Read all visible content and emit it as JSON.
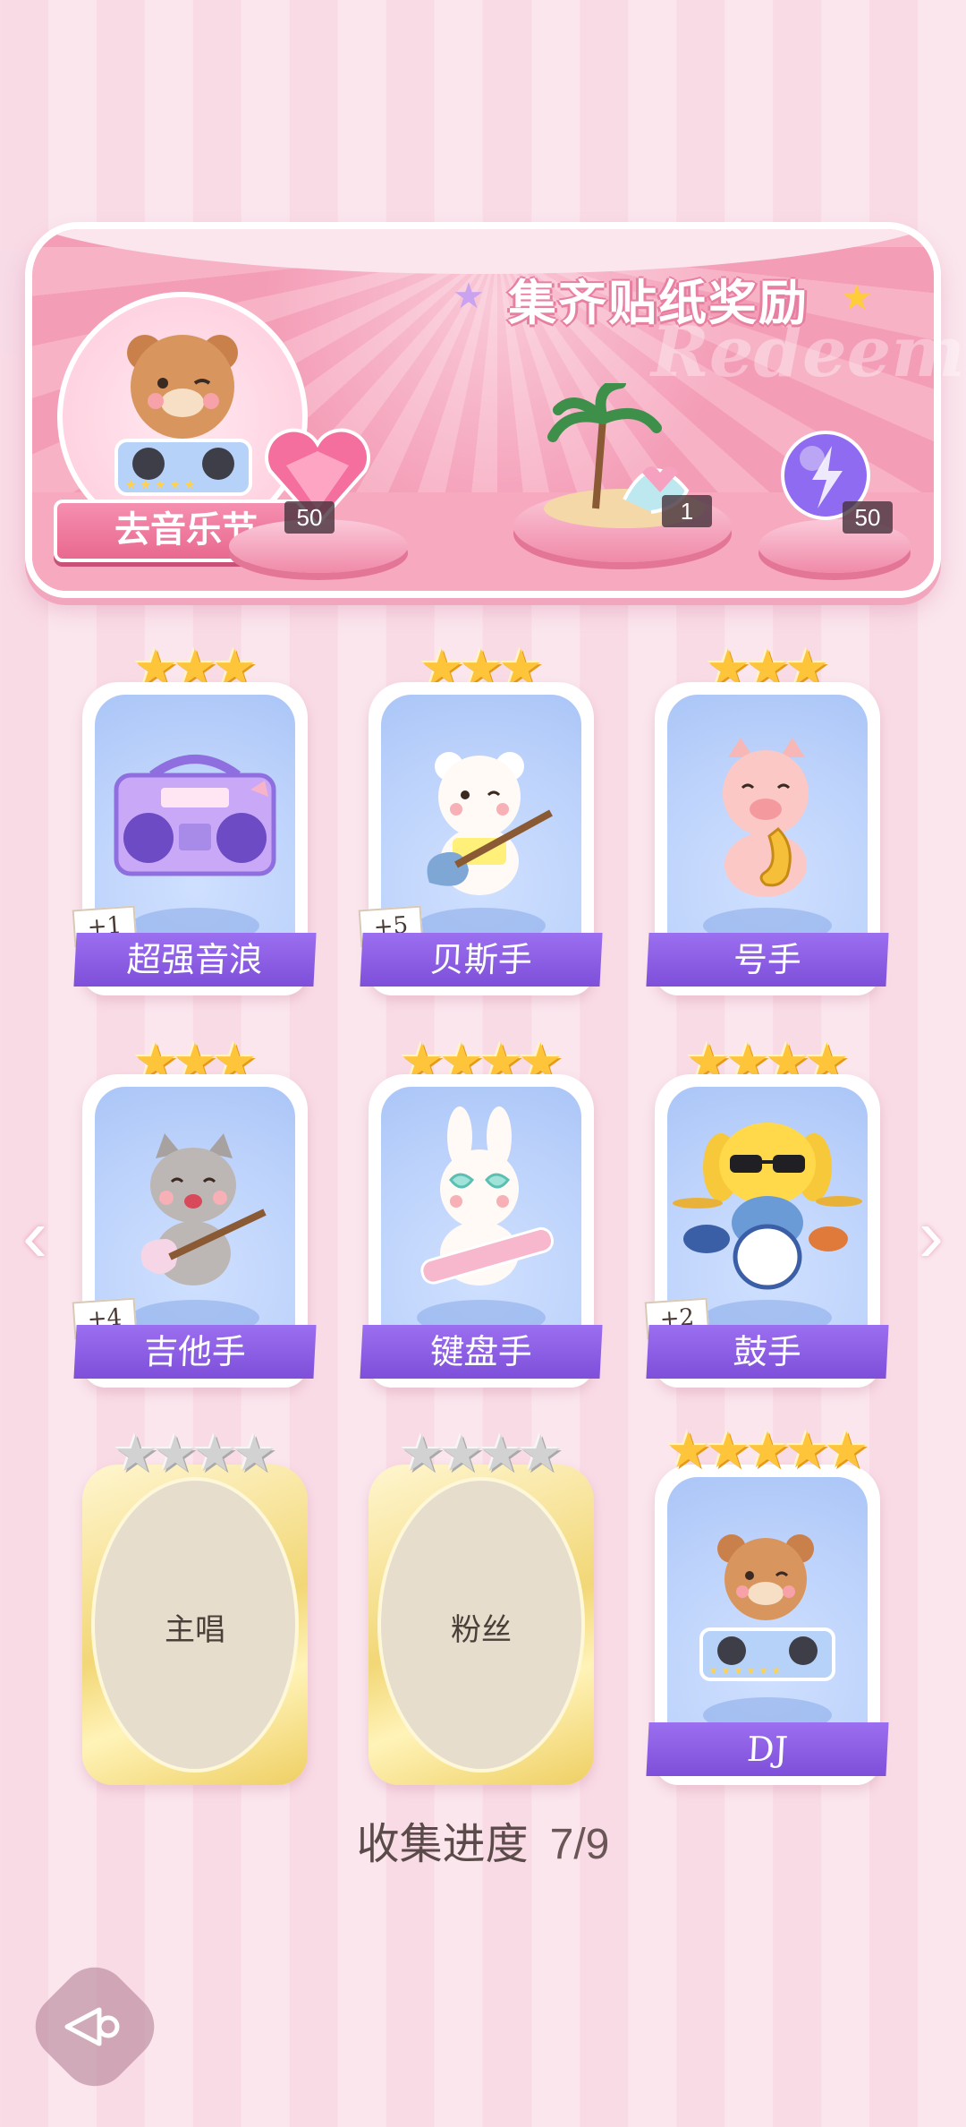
{
  "banner": {
    "title": "集齐贴纸奖励",
    "watermark": "Redeem",
    "festival_button": "去音乐节",
    "rewards": [
      {
        "icon": "heart-gem-icon",
        "count": "50"
      },
      {
        "icon": "island-icon",
        "count": "1"
      },
      {
        "icon": "energy-orb-icon",
        "count": "50"
      }
    ]
  },
  "cards": [
    {
      "label": "超强音浪",
      "stars": 3,
      "max_stars": 3,
      "bonus": "+1",
      "icon": "boombox-icon"
    },
    {
      "label": "贝斯手",
      "stars": 3,
      "max_stars": 3,
      "bonus": "+5",
      "icon": "bear-bassist-icon"
    },
    {
      "label": "号手",
      "stars": 3,
      "max_stars": 3,
      "bonus": "",
      "icon": "pig-saxophone-icon"
    },
    {
      "label": "吉他手",
      "stars": 3,
      "max_stars": 3,
      "bonus": "+4",
      "icon": "cat-guitar-icon"
    },
    {
      "label": "键盘手",
      "stars": 4,
      "max_stars": 4,
      "bonus": "",
      "icon": "bunny-keytar-icon"
    },
    {
      "label": "鼓手",
      "stars": 4,
      "max_stars": 4,
      "bonus": "+2",
      "icon": "dog-drums-icon"
    },
    {
      "label": "主唱",
      "stars": 0,
      "max_stars": 4,
      "bonus": "",
      "locked": true
    },
    {
      "label": "粉丝",
      "stars": 0,
      "max_stars": 4,
      "bonus": "",
      "locked": true
    },
    {
      "label": "DJ",
      "stars": 5,
      "max_stars": 5,
      "bonus": "",
      "icon": "bear-dj-icon"
    }
  ],
  "progress": {
    "label": "收集进度",
    "value": "7/9"
  },
  "colors": {
    "accent_purple": "#8a5ce6",
    "banner_pink": "#f49db7",
    "star_gold": "#ffc53a"
  }
}
